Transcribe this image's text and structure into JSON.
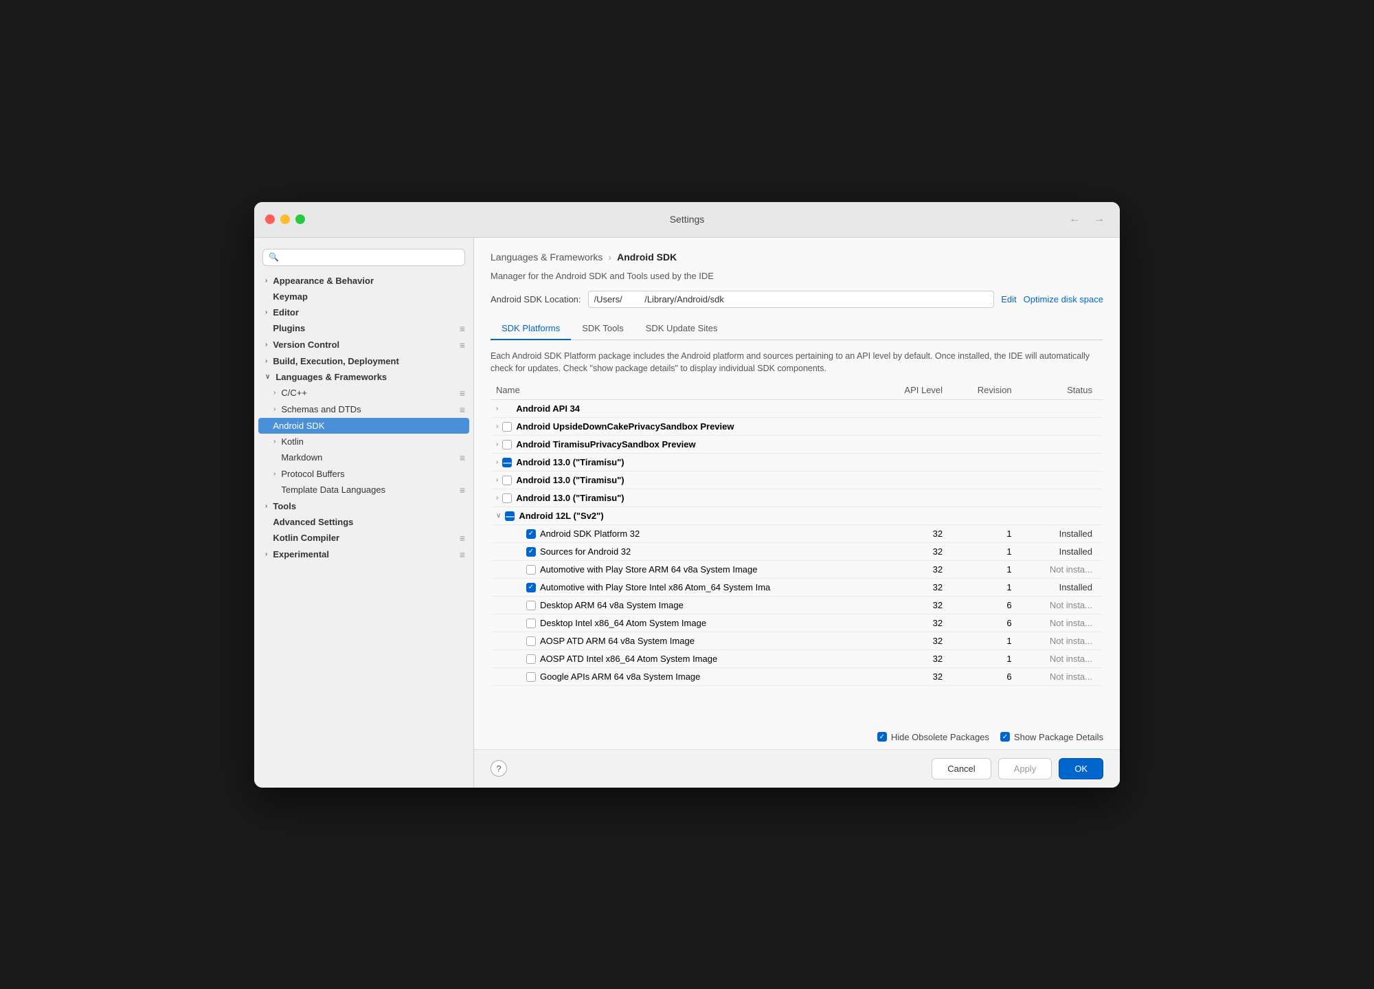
{
  "window": {
    "title": "Settings",
    "nav_back": "←",
    "nav_forward": "→"
  },
  "sidebar": {
    "search_placeholder": "",
    "items": [
      {
        "id": "appearance",
        "label": "Appearance & Behavior",
        "indent": 1,
        "arrow": "›",
        "bold": true,
        "badge": ""
      },
      {
        "id": "keymap",
        "label": "Keymap",
        "indent": 1,
        "arrow": "",
        "bold": true,
        "badge": ""
      },
      {
        "id": "editor",
        "label": "Editor",
        "indent": 1,
        "arrow": "›",
        "bold": true,
        "badge": ""
      },
      {
        "id": "plugins",
        "label": "Plugins",
        "indent": 1,
        "arrow": "",
        "bold": true,
        "badge": "≡"
      },
      {
        "id": "version-control",
        "label": "Version Control",
        "indent": 1,
        "arrow": "›",
        "bold": true,
        "badge": "≡"
      },
      {
        "id": "build",
        "label": "Build, Execution, Deployment",
        "indent": 1,
        "arrow": "›",
        "bold": true,
        "badge": ""
      },
      {
        "id": "languages",
        "label": "Languages & Frameworks",
        "indent": 1,
        "arrow": "∨",
        "bold": true,
        "badge": ""
      },
      {
        "id": "cpp",
        "label": "C/C++",
        "indent": 2,
        "arrow": "›",
        "bold": false,
        "badge": "≡"
      },
      {
        "id": "schemas",
        "label": "Schemas and DTDs",
        "indent": 2,
        "arrow": "›",
        "bold": false,
        "badge": "≡"
      },
      {
        "id": "android-sdk",
        "label": "Android SDK",
        "indent": 3,
        "arrow": "",
        "bold": false,
        "badge": "",
        "active": true
      },
      {
        "id": "kotlin",
        "label": "Kotlin",
        "indent": 2,
        "arrow": "›",
        "bold": false,
        "badge": ""
      },
      {
        "id": "markdown",
        "label": "Markdown",
        "indent": 2,
        "arrow": "",
        "bold": false,
        "badge": "≡"
      },
      {
        "id": "protocol-buffers",
        "label": "Protocol Buffers",
        "indent": 2,
        "arrow": "›",
        "bold": false,
        "badge": ""
      },
      {
        "id": "template-data",
        "label": "Template Data Languages",
        "indent": 2,
        "arrow": "",
        "bold": false,
        "badge": "≡"
      },
      {
        "id": "tools",
        "label": "Tools",
        "indent": 1,
        "arrow": "›",
        "bold": true,
        "badge": ""
      },
      {
        "id": "advanced-settings",
        "label": "Advanced Settings",
        "indent": 1,
        "arrow": "",
        "bold": true,
        "badge": ""
      },
      {
        "id": "kotlin-compiler",
        "label": "Kotlin Compiler",
        "indent": 1,
        "arrow": "",
        "bold": true,
        "badge": "≡"
      },
      {
        "id": "experimental",
        "label": "Experimental",
        "indent": 1,
        "arrow": "›",
        "bold": true,
        "badge": "≡"
      }
    ]
  },
  "main": {
    "breadcrumb_parent": "Languages & Frameworks",
    "breadcrumb_sep": "›",
    "breadcrumb_current": "Android SDK",
    "description": "Manager for the Android SDK and Tools used by the IDE",
    "sdk_location_label": "Android SDK Location:",
    "sdk_location_value": "/Users/         /Library/Android/sdk",
    "edit_label": "Edit",
    "optimize_label": "Optimize disk space",
    "table_info": "Each Android SDK Platform package includes the Android platform and sources pertaining to an\nAPI level by default. Once installed, the IDE will automatically check for updates. Check \"show\npackage details\" to display individual SDK components.",
    "tabs": [
      {
        "id": "sdk-platforms",
        "label": "SDK Platforms",
        "active": true
      },
      {
        "id": "sdk-tools",
        "label": "SDK Tools",
        "active": false
      },
      {
        "id": "sdk-update-sites",
        "label": "SDK Update Sites",
        "active": false
      }
    ],
    "table": {
      "columns": [
        "Name",
        "API Level",
        "Revision",
        "Status"
      ],
      "rows": [
        {
          "indent": 0,
          "arrow": "›",
          "checkbox": "none",
          "bold": true,
          "name": "Android API 34",
          "api": "",
          "revision": "",
          "status": ""
        },
        {
          "indent": 0,
          "arrow": "›",
          "checkbox": "empty",
          "bold": true,
          "name": "Android UpsideDownCakePrivacySandbox Preview",
          "api": "",
          "revision": "",
          "status": ""
        },
        {
          "indent": 0,
          "arrow": "›",
          "checkbox": "empty",
          "bold": true,
          "name": "Android TiramisuPrivacySandbox Preview",
          "api": "",
          "revision": "",
          "status": ""
        },
        {
          "indent": 0,
          "arrow": "›",
          "checkbox": "dash",
          "bold": true,
          "name": "Android 13.0 (\"Tiramisu\")",
          "api": "",
          "revision": "",
          "status": ""
        },
        {
          "indent": 0,
          "arrow": "›",
          "checkbox": "empty",
          "bold": true,
          "name": "Android 13.0 (\"Tiramisu\")",
          "api": "",
          "revision": "",
          "status": ""
        },
        {
          "indent": 0,
          "arrow": "›",
          "checkbox": "empty",
          "bold": true,
          "name": "Android 13.0 (\"Tiramisu\")",
          "api": "",
          "revision": "",
          "status": ""
        },
        {
          "indent": 0,
          "arrow": "∨",
          "checkbox": "dash",
          "bold": true,
          "name": "Android 12L (\"Sv2\")",
          "api": "",
          "revision": "",
          "status": ""
        },
        {
          "indent": 1,
          "arrow": "",
          "checkbox": "checked",
          "bold": false,
          "name": "Android SDK Platform 32",
          "api": "32",
          "revision": "1",
          "status": "Installed"
        },
        {
          "indent": 1,
          "arrow": "",
          "checkbox": "checked",
          "bold": false,
          "name": "Sources for Android 32",
          "api": "32",
          "revision": "1",
          "status": "Installed"
        },
        {
          "indent": 1,
          "arrow": "",
          "checkbox": "empty",
          "bold": false,
          "name": "Automotive with Play Store ARM 64 v8a System Image",
          "api": "32",
          "revision": "1",
          "status": "Not insta..."
        },
        {
          "indent": 1,
          "arrow": "",
          "checkbox": "checked",
          "bold": false,
          "name": "Automotive with Play Store Intel x86 Atom_64 System Ima",
          "api": "32",
          "revision": "1",
          "status": "Installed"
        },
        {
          "indent": 1,
          "arrow": "",
          "checkbox": "empty",
          "bold": false,
          "name": "Desktop ARM 64 v8a System Image",
          "api": "32",
          "revision": "6",
          "status": "Not insta..."
        },
        {
          "indent": 1,
          "arrow": "",
          "checkbox": "empty",
          "bold": false,
          "name": "Desktop Intel x86_64 Atom System Image",
          "api": "32",
          "revision": "6",
          "status": "Not insta..."
        },
        {
          "indent": 1,
          "arrow": "",
          "checkbox": "empty",
          "bold": false,
          "name": "AOSP ATD ARM 64 v8a System Image",
          "api": "32",
          "revision": "1",
          "status": "Not insta..."
        },
        {
          "indent": 1,
          "arrow": "",
          "checkbox": "empty",
          "bold": false,
          "name": "AOSP ATD Intel x86_64 Atom System Image",
          "api": "32",
          "revision": "1",
          "status": "Not insta..."
        },
        {
          "indent": 1,
          "arrow": "",
          "checkbox": "empty",
          "bold": false,
          "name": "Google APIs ARM 64 v8a System Image",
          "api": "32",
          "revision": "6",
          "status": "Not insta..."
        }
      ]
    },
    "footer": {
      "hide_obsolete_label": "Hide Obsolete Packages",
      "hide_obsolete_checked": true,
      "show_package_label": "Show Package Details",
      "show_package_checked": true
    },
    "buttons": {
      "cancel": "Cancel",
      "apply": "Apply",
      "ok": "OK"
    }
  }
}
